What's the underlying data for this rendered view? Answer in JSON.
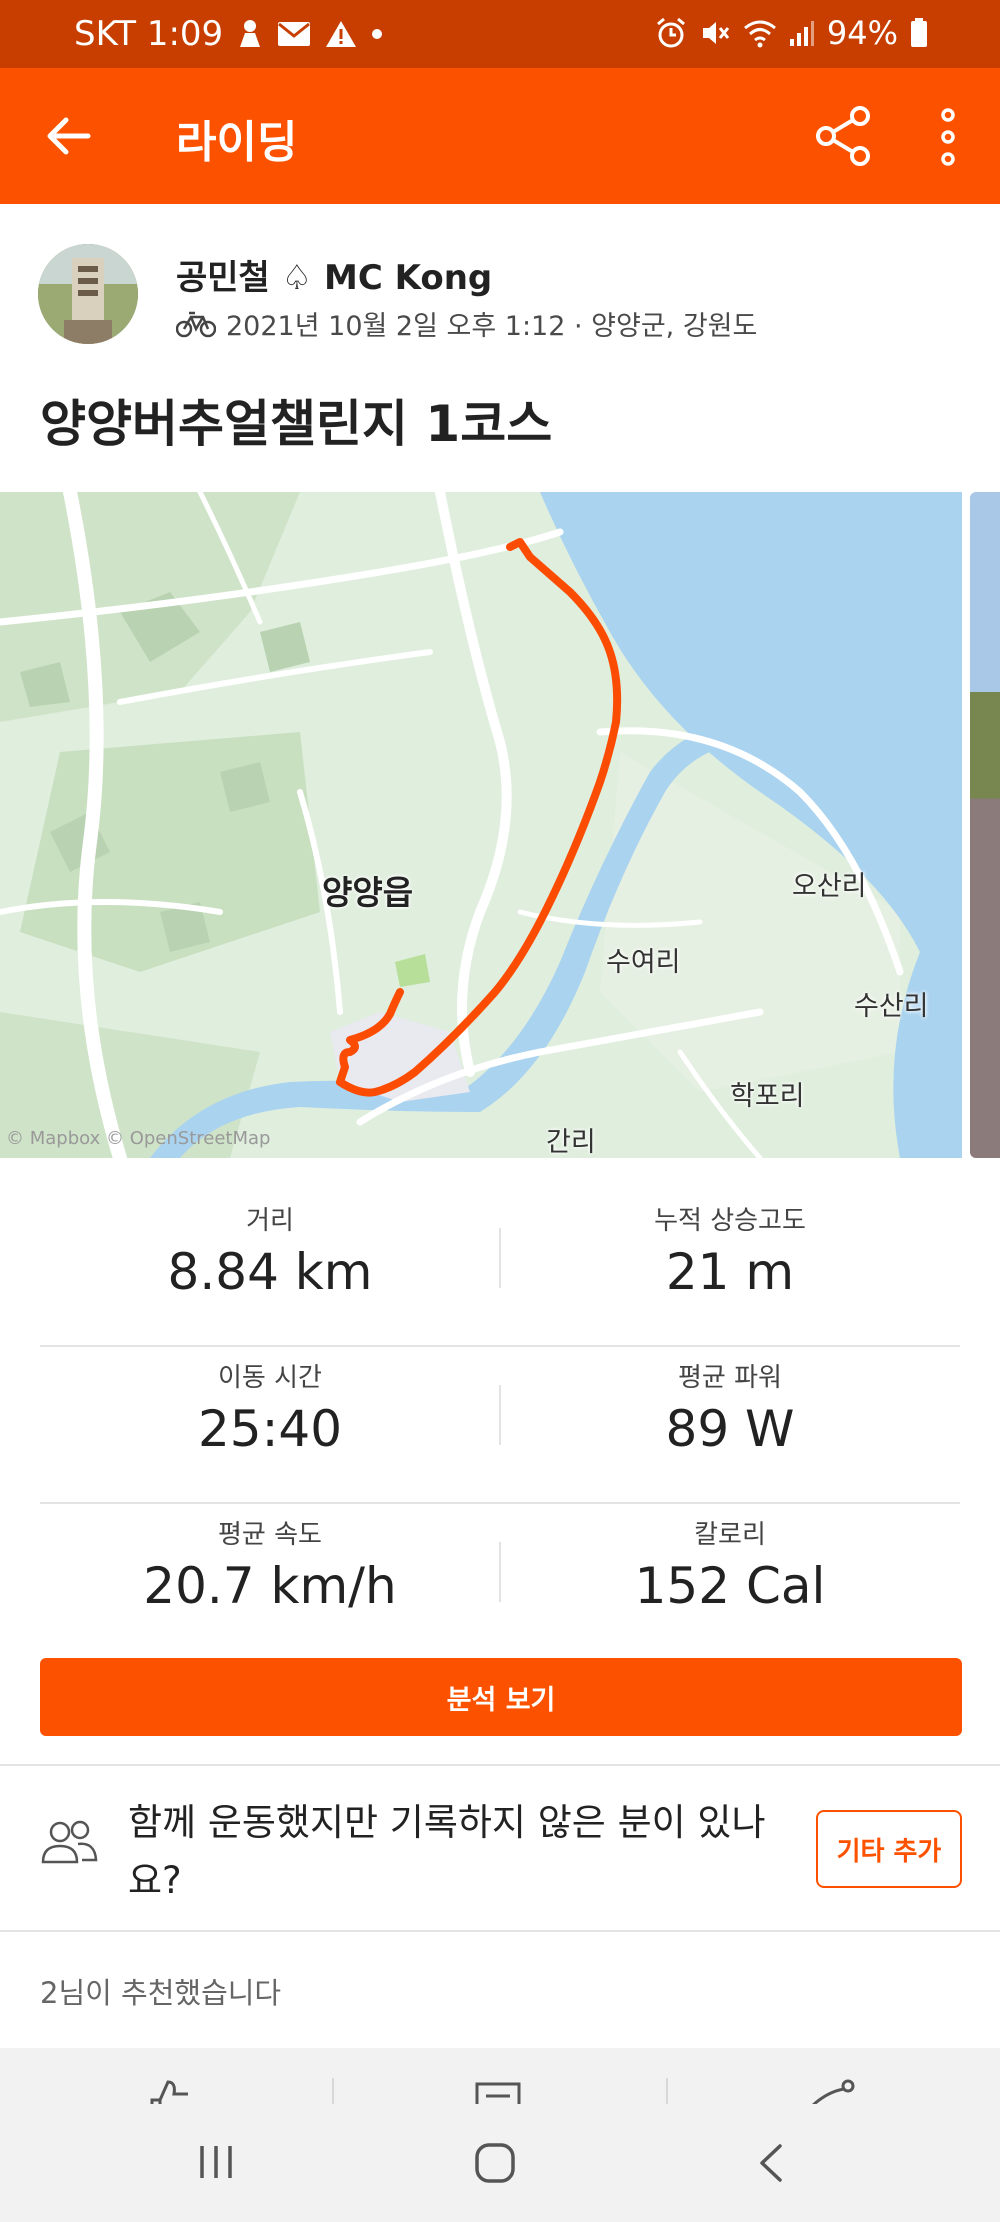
{
  "status_bar": {
    "carrier_time": "SKT 1:09",
    "battery": "94%",
    "icons": [
      "person-icon",
      "mail-icon",
      "warning-icon",
      "dot-icon",
      "alarm-icon",
      "mute-icon",
      "wifi-icon",
      "signal-icon",
      "battery-icon"
    ]
  },
  "app_bar": {
    "title": "라이딩",
    "icons": [
      "back-arrow-icon",
      "share-icon",
      "more-vert-icon"
    ]
  },
  "activity": {
    "athlete_name": "공민철 ♤ MC Kong",
    "date_location": "2021년 10월 2일 오후 1:12 · 양양군, 강원도",
    "title": "양양버추얼챌린지 1코스",
    "sport_icon": "bike-icon"
  },
  "map": {
    "labels": {
      "town": "양양읍",
      "osan": "오산리",
      "suyeo": "수여리",
      "susan": "수산리",
      "hakpo": "학포리",
      "gan": "간리"
    },
    "credit": "© Mapbox © OpenStreetMap",
    "colors": {
      "route": "#fc4c02",
      "water": "#aad3f0",
      "land": "#dfeedd"
    }
  },
  "stats": [
    {
      "label": "거리",
      "value": "8.84 km"
    },
    {
      "label": "누적 상승고도",
      "value": "21 m"
    },
    {
      "label": "이동 시간",
      "value": "25:40"
    },
    {
      "label": "평균 파워",
      "value": "89 W"
    },
    {
      "label": "평균 속도",
      "value": "20.7 km/h"
    },
    {
      "label": "칼로리",
      "value": "152 Cal"
    }
  ],
  "actions": {
    "analysis_button": "분석 보기",
    "group_prompt": "함께 운동했지만 기록하지 않은 분이 있나요?",
    "add_other_button": "기타 추가",
    "kudos_text": "2님이 추천했습니다"
  },
  "colors": {
    "accent": "#fc5200",
    "status_bar": "#c73e00"
  }
}
